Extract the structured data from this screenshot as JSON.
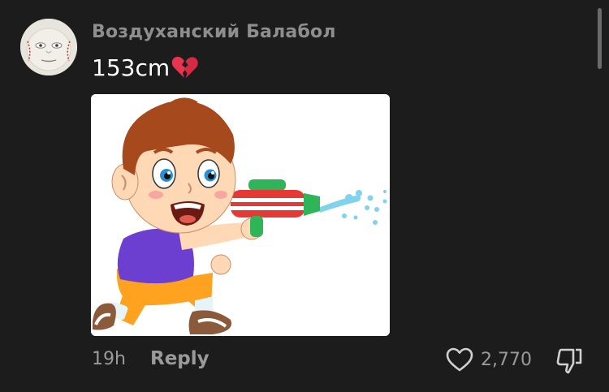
{
  "comment": {
    "author": "Воздуханский Балабол",
    "text": "153cm",
    "emoji": "broken-heart",
    "attachment": "cartoon boy with water gun image",
    "timestamp": "19h",
    "reply_label": "Reply",
    "like_count": "2,770"
  },
  "icons": {
    "like": "heart-outline-icon",
    "dislike": "thumbs-down-outline-icon"
  },
  "colors": {
    "background": "#1c1c1c",
    "username": "#8e8e8e",
    "secondary_text": "#9a9a9a",
    "primary_text": "#ffffff"
  }
}
